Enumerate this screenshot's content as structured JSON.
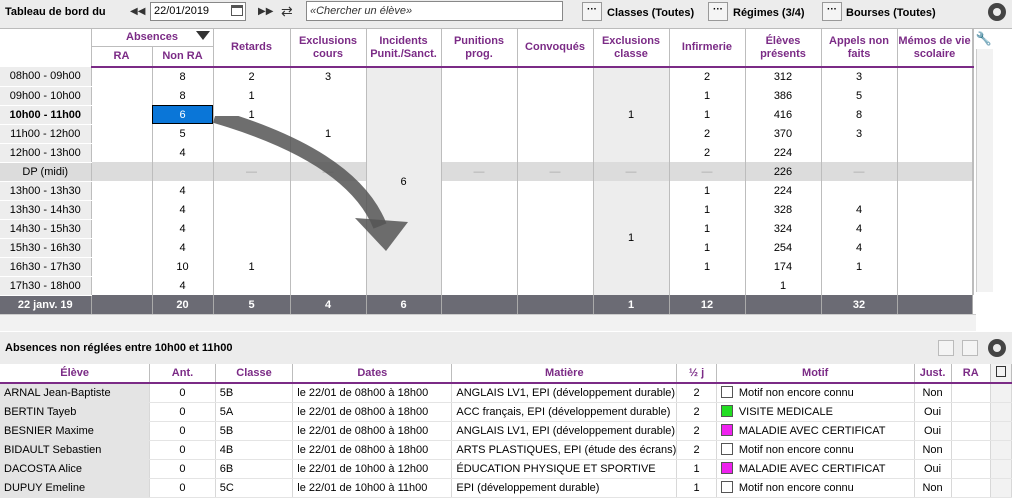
{
  "toolbar": {
    "title": "Tableau de bord du",
    "date": "22/01/2019",
    "search_placeholder": "«Chercher un élève»",
    "classes_label": "Classes (Toutes)",
    "regimes_label": "Régimes (3/4)",
    "bourses_label": "Bourses (Toutes)",
    "dots": "···"
  },
  "grid": {
    "group_header": "Absences",
    "columns": [
      "RA",
      "Non RA",
      "Retards",
      "Exclusions cours",
      "Incidents Punit./Sanct.",
      "Punitions prog.",
      "Convoqués",
      "Exclusions classe",
      "Infirmerie",
      "Élèves présents",
      "Appels non faits",
      "Mémos de vie scolaire"
    ],
    "rows": [
      {
        "slot": "08h00 - 09h00",
        "ra": "",
        "nonra": "8",
        "retards": "2",
        "excl": "3",
        "infirm": "2",
        "presents": "312",
        "appels": "3"
      },
      {
        "slot": "09h00 - 10h00",
        "ra": "",
        "nonra": "8",
        "retards": "1",
        "excl": "",
        "infirm": "1",
        "presents": "386",
        "appels": "5"
      },
      {
        "slot": "10h00 - 11h00",
        "ra": "",
        "nonra": "6",
        "retards": "1",
        "excl": "",
        "infirm": "1",
        "presents": "416",
        "appels": "8"
      },
      {
        "slot": "11h00 - 12h00",
        "ra": "",
        "nonra": "5",
        "retards": "",
        "excl": "1",
        "infirm": "2",
        "presents": "370",
        "appels": "3"
      },
      {
        "slot": "12h00 - 13h00",
        "ra": "",
        "nonra": "4",
        "retards": "",
        "excl": "",
        "infirm": "2",
        "presents": "224",
        "appels": ""
      },
      {
        "slot": "DP (midi)",
        "ra": "",
        "nonra": "",
        "retards": "",
        "excl": "",
        "infirm": "",
        "presents": "226",
        "appels": ""
      },
      {
        "slot": "13h00 - 13h30",
        "ra": "",
        "nonra": "4",
        "retards": "",
        "excl": "",
        "infirm": "1",
        "presents": "224",
        "appels": ""
      },
      {
        "slot": "13h30 - 14h30",
        "ra": "",
        "nonra": "4",
        "retards": "",
        "excl": "",
        "infirm": "1",
        "presents": "328",
        "appels": "4"
      },
      {
        "slot": "14h30 - 15h30",
        "ra": "",
        "nonra": "4",
        "retards": "",
        "excl": "",
        "infirm": "1",
        "presents": "324",
        "appels": "4"
      },
      {
        "slot": "15h30 - 16h30",
        "ra": "",
        "nonra": "4",
        "retards": "",
        "excl": "",
        "infirm": "1",
        "presents": "254",
        "appels": "4"
      },
      {
        "slot": "16h30 - 17h30",
        "ra": "",
        "nonra": "10",
        "retards": "1",
        "excl": "",
        "infirm": "1",
        "presents": "174",
        "appels": "1"
      },
      {
        "slot": "17h30 - 18h00",
        "ra": "",
        "nonra": "4",
        "retards": "",
        "excl": "",
        "infirm": "",
        "presents": "1",
        "appels": ""
      }
    ],
    "incidents_merged": "6",
    "exclusions_classe_morning": "1",
    "exclusions_classe_afternoon": "1",
    "dash": "—",
    "totals": {
      "label": "22 janv. 19",
      "ra": "",
      "nonra": "20",
      "retards": "5",
      "excl": "4",
      "incidents": "6",
      "punitions": "",
      "convoques": "",
      "exclclasse": "1",
      "infirm": "12",
      "presents": "",
      "appels": "32",
      "memos": ""
    }
  },
  "section_title": "Absences non réglées entre 10h00 et 11h00",
  "list": {
    "columns": [
      "Élève",
      "Ant.",
      "Classe",
      "Dates",
      "Matière",
      "½ j",
      "Motif",
      "Just.",
      "RA"
    ],
    "rows": [
      {
        "eleve": "ARNAL Jean-Baptiste",
        "ant": "0",
        "classe": "5B",
        "dates": "le 22/01 de 08h00 à 18h00",
        "matiere": "ANGLAIS LV1, EPI (développement durable)",
        "demi": "2",
        "motif": "Motif non encore connu",
        "motif_color": "#ffffff",
        "just": "Non",
        "ra": ""
      },
      {
        "eleve": "BERTIN Tayeb",
        "ant": "0",
        "classe": "5A",
        "dates": "le 22/01 de 08h00 à 18h00",
        "matiere": "ACC français, EPI (développement durable)",
        "demi": "2",
        "motif": "VISITE MEDICALE",
        "motif_color": "#22dd22",
        "just": "Oui",
        "ra": ""
      },
      {
        "eleve": "BESNIER Maxime",
        "ant": "0",
        "classe": "5B",
        "dates": "le 22/01 de 08h00 à 18h00",
        "matiere": "ANGLAIS LV1, EPI (développement durable)",
        "demi": "2",
        "motif": "MALADIE AVEC CERTIFICAT",
        "motif_color": "#ee22ee",
        "just": "Oui",
        "ra": ""
      },
      {
        "eleve": "BIDAULT Sebastien",
        "ant": "0",
        "classe": "4B",
        "dates": "le 22/01 de 08h00 à 18h00",
        "matiere": "ARTS PLASTIQUES, EPI (étude des écrans)",
        "demi": "2",
        "motif": "Motif non encore connu",
        "motif_color": "#ffffff",
        "just": "Non",
        "ra": ""
      },
      {
        "eleve": "DACOSTA Alice",
        "ant": "0",
        "classe": "6B",
        "dates": "le 22/01 de 10h00 à 12h00",
        "matiere": "ÉDUCATION PHYSIQUE ET SPORTIVE",
        "demi": "1",
        "motif": "MALADIE AVEC CERTIFICAT",
        "motif_color": "#ee22ee",
        "just": "Oui",
        "ra": ""
      },
      {
        "eleve": "DUPUY Emeline",
        "ant": "0",
        "classe": "5C",
        "dates": "le 22/01 de 10h00 à 11h00",
        "matiere": "EPI (développement durable)",
        "demi": "1",
        "motif": "Motif non encore connu",
        "motif_color": "#ffffff",
        "just": "Non",
        "ra": ""
      }
    ]
  }
}
